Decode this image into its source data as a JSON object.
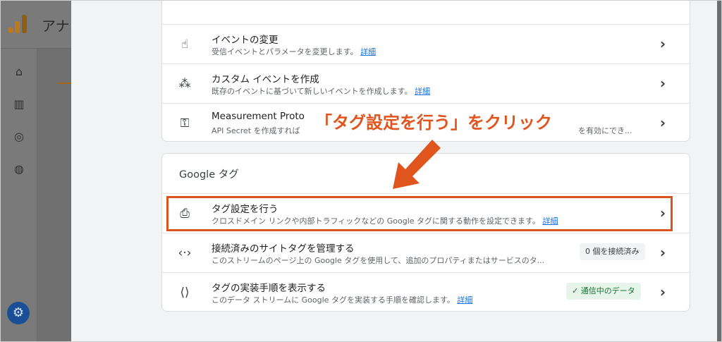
{
  "app": {
    "title": "アナ"
  },
  "nav": {
    "icons": [
      "home-icon",
      "reports-icon",
      "explore-icon",
      "advertising-icon"
    ],
    "settings_icon": "gear-icon"
  },
  "events_card": {
    "rows": [
      {
        "icon": "touch-icon",
        "title": "イベントの変更",
        "desc": "受信イベントとパラメータを変更します。",
        "link": "詳細"
      },
      {
        "icon": "sparkle-cursor-icon",
        "title": "カスタム イベントを作成",
        "desc": "既存のイベントに基づいて新しいイベントを作成します。",
        "link": "詳細"
      },
      {
        "icon": "key-icon",
        "title": "Measurement Proto",
        "desc": "API Secret を作成すれば",
        "desc_tail": "を有効にでき..."
      }
    ]
  },
  "google_tag_card": {
    "heading": "Google タグ",
    "rows": [
      {
        "icon": "tag-icon",
        "title": "タグ設定を行う",
        "desc": "クロスドメイン リンクや内部トラフィックなどの Google タグに関する動作を設定できます。",
        "link": "詳細"
      },
      {
        "icon": "code-arrows-icon",
        "title": "接続済みのサイトタグを管理する",
        "desc": "このストリームのページ上の Google タグを使用して、追加のプロパティまたはサービスのタ...",
        "badge": "0 個を接続済み"
      },
      {
        "icon": "code-doc-icon",
        "title": "タグの実装手順を表示する",
        "desc": "このデータ ストリームに Google タグを実装する手順を確認します。",
        "link": "詳細",
        "badge": "✓ 通信中のデータ"
      }
    ]
  },
  "annotation": {
    "callout": "「タグ設定を行う」をクリック",
    "color": "#e0541e"
  }
}
